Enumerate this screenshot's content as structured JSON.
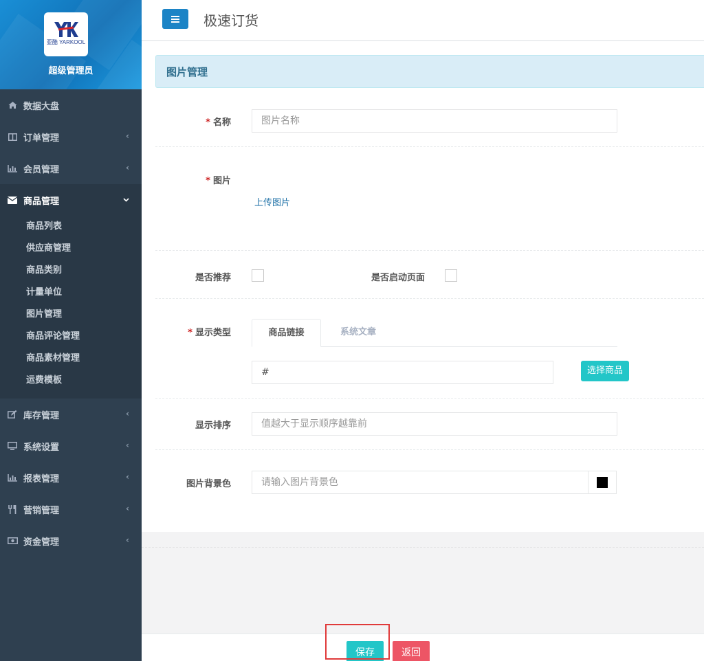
{
  "sidebar": {
    "profile_name": "超级管理员",
    "logo_text": "亚酷 YARKOOL",
    "menu": [
      {
        "label": "数据大盘",
        "icon": "home-icon"
      },
      {
        "label": "订单管理",
        "icon": "columns-icon"
      },
      {
        "label": "会员管理",
        "icon": "bar-chart-icon"
      },
      {
        "label": "商品管理",
        "icon": "envelope-icon",
        "active": true
      },
      {
        "label": "库存管理",
        "icon": "edit-icon"
      },
      {
        "label": "系统设置",
        "icon": "desktop-icon"
      },
      {
        "label": "报表管理",
        "icon": "bar-chart-icon"
      },
      {
        "label": "营销管理",
        "icon": "cutlery-icon"
      },
      {
        "label": "资金管理",
        "icon": "money-icon"
      }
    ],
    "submenu": [
      "商品列表",
      "供应商管理",
      "商品类别",
      "计量单位",
      "图片管理",
      "商品评论管理",
      "商品素材管理",
      "运费模板"
    ]
  },
  "topbar": {
    "title": "极速订货"
  },
  "form": {
    "header": "图片管理",
    "name_label": "名称",
    "name_placeholder": "图片名称",
    "image_label": "图片",
    "upload_link": "上传图片",
    "recommend_label": "是否推荐",
    "startup_label": "是否启动页面",
    "display_type_label": "显示类型",
    "tab_product_link": "商品链接",
    "tab_system_article": "系统文章",
    "link_value": "#",
    "select_product_button": "选择商品",
    "sort_label": "显示排序",
    "sort_placeholder": "值越大于显示顺序越靠前",
    "bgcolor_label": "图片背景色",
    "bgcolor_placeholder": "请输入图片背景色",
    "bgcolor_swatch": "#000000"
  },
  "footer": {
    "save_button": "保存",
    "back_button": "返回"
  },
  "colors": {
    "sidebar_bg": "#2f4050",
    "primary": "#1c84c6",
    "info": "#23c6c8",
    "danger": "#ed5565"
  }
}
